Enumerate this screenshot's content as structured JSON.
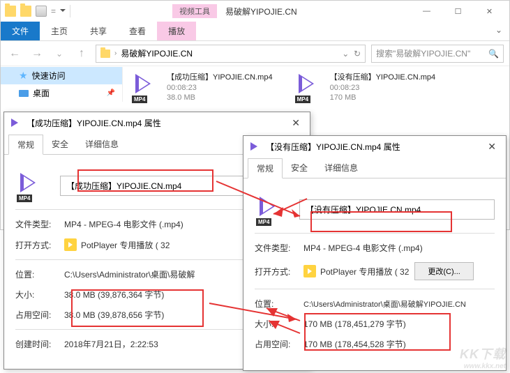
{
  "explorer": {
    "tool_badge": "视频工具",
    "title": "易破解YIPOJIE.CN",
    "tabs": {
      "file": "文件",
      "home": "主页",
      "share": "共享",
      "view": "查看",
      "play": "播放"
    },
    "breadcrumb": "易破解YIPOJIE.CN",
    "search_placeholder": "搜索\"易破解YIPOJIE.CN\"",
    "tree": {
      "quick": "快速访问",
      "desktop": "桌面"
    },
    "files": [
      {
        "name": "【成功压缩】YIPOJIE.CN.mp4",
        "duration": "00:08:23",
        "size": "38.0 MB"
      },
      {
        "name": "【没有压缩】YIPOJIE.CN.mp4",
        "duration": "00:08:23",
        "size": "170 MB"
      }
    ]
  },
  "dlg1": {
    "title": "【成功压缩】YIPOJIE.CN.mp4 属性",
    "tabs": {
      "general": "常规",
      "security": "安全",
      "details": "详细信息"
    },
    "filename": "【成功压缩】YIPOJIE.CN.mp4",
    "type_lbl": "文件类型:",
    "type_val": "MP4 - MPEG-4 电影文件 (.mp4)",
    "open_lbl": "打开方式:",
    "open_val": "PotPlayer 专用播放 ( 32",
    "loc_lbl": "位置:",
    "loc_val": "C:\\Users\\Administrator\\桌面\\易破解",
    "size_lbl": "大小:",
    "size_val": "38.0 MB (39,876,364 字节)",
    "disk_lbl": "占用空间:",
    "disk_val": "38.0 MB (39,878,656 字节)",
    "created_lbl": "创建时间:",
    "created_val": "2018年7月21日，2:22:53"
  },
  "dlg2": {
    "title": "【没有压缩】YIPOJIE.CN.mp4 属性",
    "tabs": {
      "general": "常规",
      "security": "安全",
      "details": "详细信息"
    },
    "filename": "【没有压缩】YIPOJIE.CN.mp4",
    "type_lbl": "文件类型:",
    "type_val": "MP4 - MPEG-4 电影文件 (.mp4)",
    "open_lbl": "打开方式:",
    "open_val": "PotPlayer 专用播放 ( 32",
    "change_btn": "更改(C)...",
    "loc_lbl": "位置:",
    "loc_val": "C:\\Users\\Administrator\\桌面\\易破解YIPOJIE.CN",
    "size_lbl": "大小:",
    "size_val": "170 MB (178,451,279 字节)",
    "disk_lbl": "占用空间:",
    "disk_val": "170 MB (178,454,528 字节)"
  },
  "watermark": {
    "brand": "KK下载",
    "url": "www.kkx.net"
  }
}
